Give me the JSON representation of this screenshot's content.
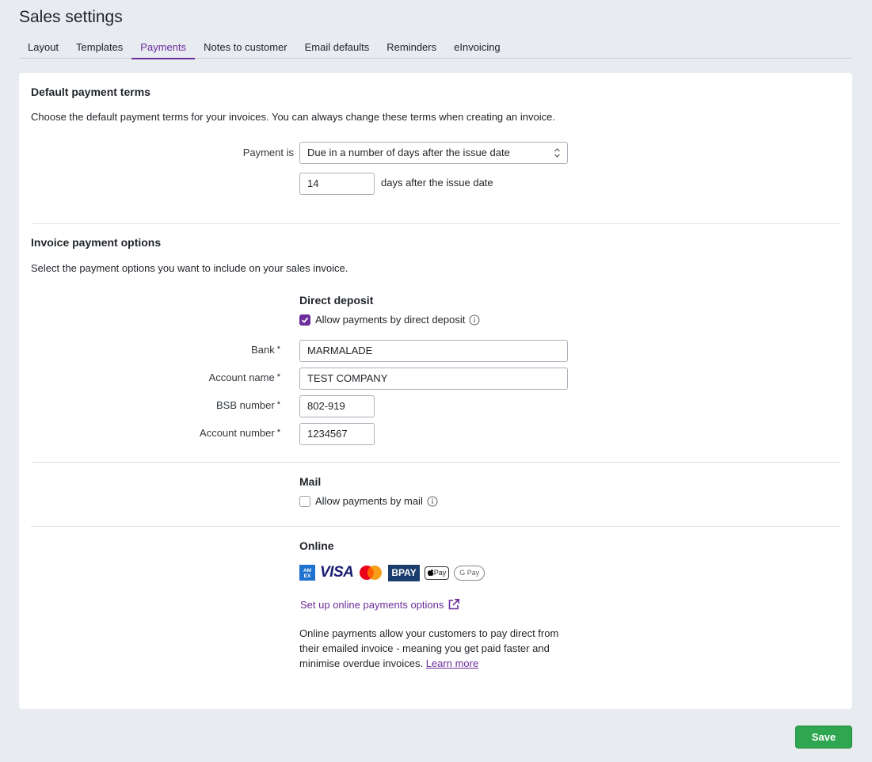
{
  "page": {
    "title": "Sales settings"
  },
  "tabs": [
    {
      "label": "Layout",
      "active": false
    },
    {
      "label": "Templates",
      "active": false
    },
    {
      "label": "Payments",
      "active": true
    },
    {
      "label": "Notes to customer",
      "active": false
    },
    {
      "label": "Email defaults",
      "active": false
    },
    {
      "label": "Reminders",
      "active": false
    },
    {
      "label": "eInvoicing",
      "active": false
    }
  ],
  "payment_terms": {
    "heading": "Default payment terms",
    "description": "Choose the default payment terms for your invoices. You can always change these terms when creating an invoice.",
    "payment_is_label": "Payment is",
    "payment_is_value": "Due in a number of days after the issue date",
    "days_value": "14",
    "days_suffix": "days after the issue date"
  },
  "payment_options": {
    "heading": "Invoice payment options",
    "description": "Select the payment options you want to include on your sales invoice.",
    "direct_deposit": {
      "heading": "Direct deposit",
      "checkbox_label": "Allow payments by direct deposit",
      "checked": true,
      "bank_label": "Bank",
      "bank_value": "MARMALADE",
      "account_name_label": "Account name",
      "account_name_value": "TEST COMPANY",
      "bsb_label": "BSB number",
      "bsb_value": "802-919",
      "account_number_label": "Account number",
      "account_number_value": "1234567",
      "required_marker": "*"
    },
    "mail": {
      "heading": "Mail",
      "checkbox_label": "Allow payments by mail",
      "checked": false
    },
    "online": {
      "heading": "Online",
      "card_logos": [
        "amex-logo",
        "visa-logo",
        "mastercard-logo",
        "bpay-logo",
        "apple-pay-logo",
        "google-pay-logo"
      ],
      "visa_text": "VISA",
      "bpay_text": "BPAY",
      "applepay_text": "Pay",
      "gpay_text": "G Pay",
      "setup_link": "Set up online payments options",
      "description": "Online payments allow your customers to pay direct from their emailed invoice - meaning you get paid faster and minimise overdue invoices.",
      "learn_more": "Learn more"
    }
  },
  "footer": {
    "save_label": "Save"
  },
  "colors": {
    "accent": "#6b2d9a",
    "save": "#2fa650",
    "background": "#e8ebf0"
  }
}
